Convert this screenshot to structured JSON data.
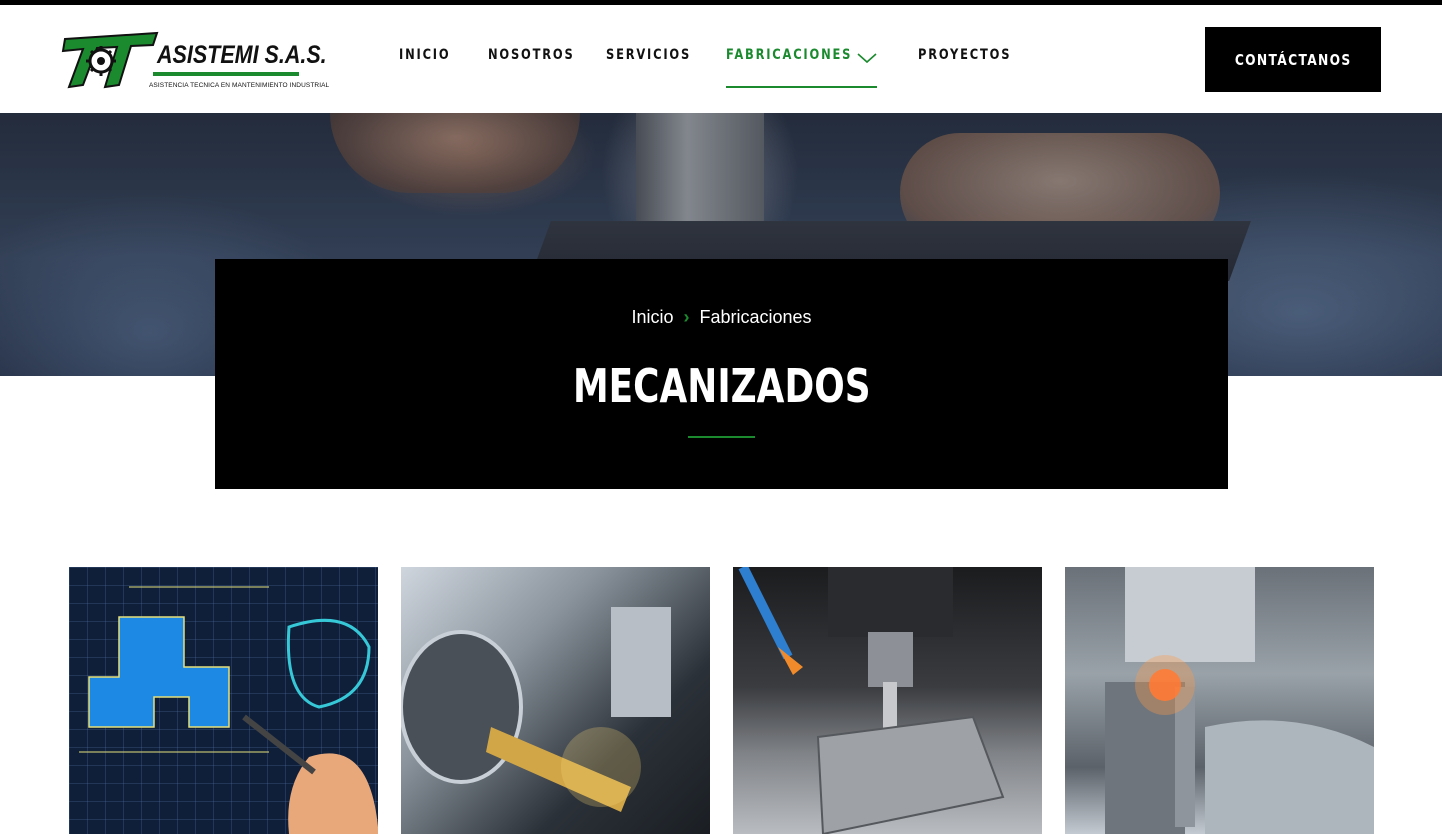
{
  "brand": {
    "name": "ASISTEMI S.A.S.",
    "tagline": "ASISTENCIA TECNICA EN MANTENIMIENTO INDUSTRIAL",
    "color_primary": "#1b8a2f",
    "color_dark": "#000000"
  },
  "nav": {
    "items": [
      {
        "label": "INICIO",
        "active": false
      },
      {
        "label": "NOSOTROS",
        "active": false
      },
      {
        "label": "SERVICIOS",
        "active": false
      },
      {
        "label": "FABRICACIONES",
        "active": true,
        "has_dropdown": true,
        "icon": "chevron-down-icon"
      },
      {
        "label": "PROYECTOS",
        "active": false
      }
    ],
    "cta_label": "CONTÁCTANOS"
  },
  "hero": {
    "breadcrumb": [
      "Inicio",
      "Fabricaciones"
    ],
    "breadcrumb_separator_icon": "chevron-right-icon",
    "title": "MECANIZADOS"
  },
  "gallery": {
    "images": [
      {
        "subject": "technical-drawing"
      },
      {
        "subject": "cnc-lathe"
      },
      {
        "subject": "milling-machine"
      },
      {
        "subject": "edm-machining"
      }
    ]
  }
}
